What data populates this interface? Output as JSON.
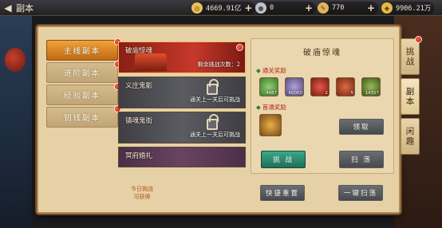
{
  "topbar": {
    "title": "副本",
    "resources": [
      {
        "icon": "gold-coin-icon",
        "value": "4669.91亿",
        "color": "#e8c25a"
      },
      {
        "icon": "silver-coin-icon",
        "value": "0",
        "color": "#bfc4cc"
      },
      {
        "icon": "scroll-icon",
        "value": "770",
        "color": "#e0b55a"
      },
      {
        "icon": "gold-ingot-icon",
        "value": "9906.21万",
        "color": "#e7b845"
      }
    ]
  },
  "tabs": [
    "主线副本",
    "进阶副本",
    "经验副本",
    "钥钱副本"
  ],
  "dungeons": [
    {
      "name": "破庙惊魂",
      "info": "剩余挑战次数：2"
    },
    {
      "name": "义庄鬼影",
      "info": "通关上一关后可挑战"
    },
    {
      "name": "镇魂鬼街",
      "info": "通关上一关后可挑战"
    },
    {
      "name": "冥府婚礼",
      "info": ""
    }
  ],
  "detail": {
    "title": "破庙惊魂",
    "clear_reward_label": "通关奖励",
    "first_reward_label": "首通奖励",
    "clear_rewards": [
      {
        "icon": "jade-coin-icon",
        "count": "4487",
        "color": "#6fb05a"
      },
      {
        "icon": "silver-orb-icon",
        "count": "60000",
        "color": "#8a7ab0"
      },
      {
        "icon": "red-gift-icon",
        "count": "2",
        "color": "#c7382a"
      },
      {
        "icon": "treasure-box-icon",
        "count": "5",
        "color": "#b23a26"
      },
      {
        "icon": "copper-coin-icon",
        "count": "14357",
        "color": "#6a8a3a"
      }
    ],
    "first_reward_icon": "golden-chest-icon",
    "claim_button": "领取",
    "challenge_button": "挑 战",
    "sweep_button": "扫 荡"
  },
  "bottom": {
    "note_line1": "今日挑战",
    "note_line2": "可获得",
    "quick_reset_button": "快捷重置",
    "one_key_sweep_button": "一键扫荡"
  },
  "side_tabs": [
    "挑战",
    "副本",
    "闲趣"
  ]
}
